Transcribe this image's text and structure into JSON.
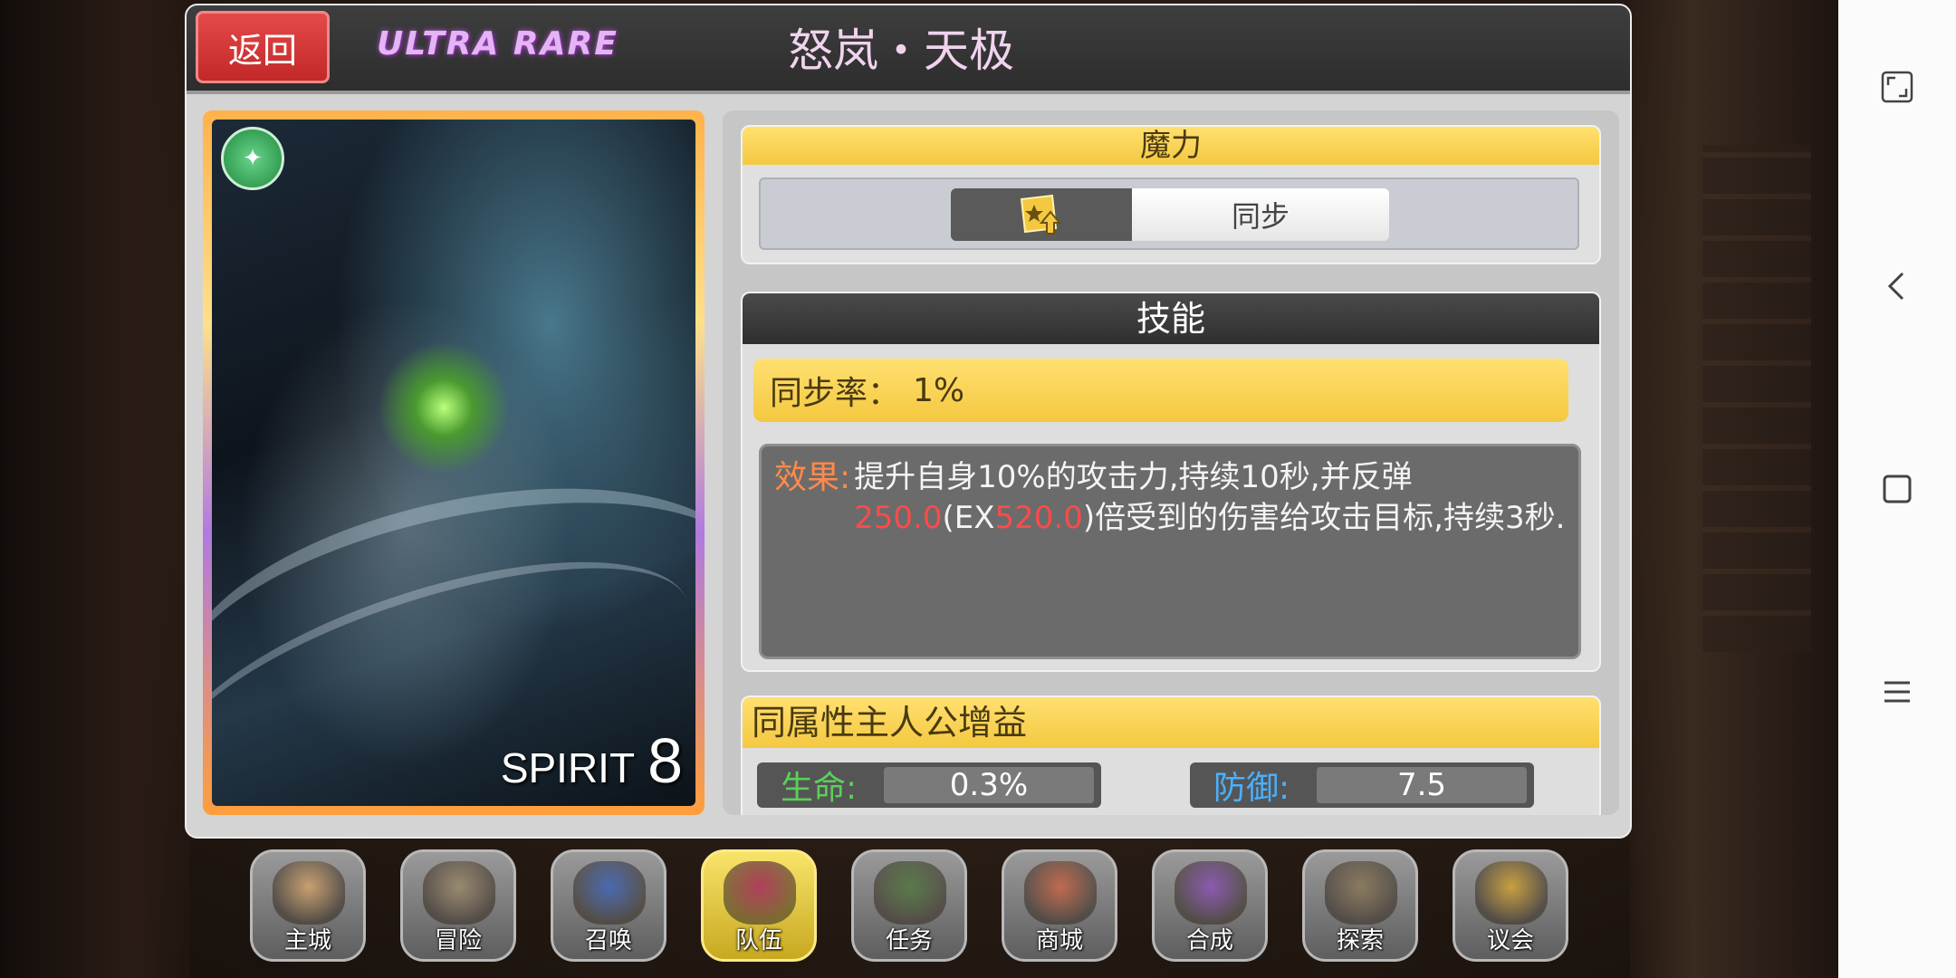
{
  "header": {
    "back_label": "返回",
    "rarity": "ULTRA RARE",
    "title": "怒岚・天极"
  },
  "card": {
    "spirit_label": "SPIRIT",
    "spirit_value": "8"
  },
  "mana": {
    "header": "魔力",
    "toggle_label": "同步"
  },
  "skill": {
    "header": "技能",
    "sync_label": "同步率：",
    "sync_value": "1%",
    "effect_label": "效果:",
    "effect_text_1": "提升自身10%的攻击力,持续10秒,并反弹",
    "effect_red_1": "250.0",
    "effect_text_2": "(EX",
    "effect_red_2": "520.0",
    "effect_text_3": ")倍受到的伤害给攻击目标,持续3秒."
  },
  "bonus": {
    "header": "同属性主人公增益",
    "stats": [
      {
        "label": "生命:",
        "value": "0.3%",
        "color": "#5ad05a"
      },
      {
        "label": "防御:",
        "value": "7.5",
        "color": "#4ab0ff"
      }
    ]
  },
  "bottom_nav": [
    {
      "label": "主城",
      "icon": "castle-icon",
      "color": "#c8a070"
    },
    {
      "label": "冒险",
      "icon": "crossed-weapons-icon",
      "color": "#9a8a70"
    },
    {
      "label": "召唤",
      "icon": "summon-card-icon",
      "color": "#4a6ab0"
    },
    {
      "label": "队伍",
      "icon": "winged-shield-icon",
      "color": "#b0405a",
      "active": true
    },
    {
      "label": "任务",
      "icon": "quest-book-icon",
      "color": "#5a7a4a"
    },
    {
      "label": "商城",
      "icon": "shop-icon",
      "color": "#c06a50"
    },
    {
      "label": "合成",
      "icon": "potion-icon",
      "color": "#8a5ab0"
    },
    {
      "label": "探索",
      "icon": "shovel-icon",
      "color": "#8a7a60"
    },
    {
      "label": "议会",
      "icon": "council-emblem-icon",
      "color": "#c8a040"
    }
  ]
}
